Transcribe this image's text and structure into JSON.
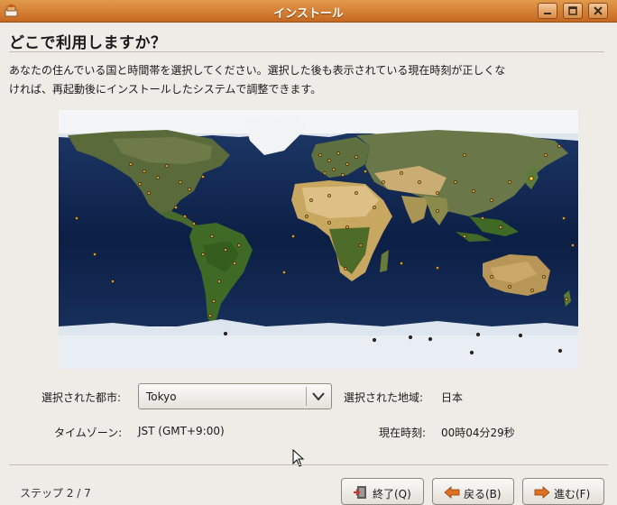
{
  "window": {
    "title": "インストール"
  },
  "page": {
    "heading": "どこで利用しますか？",
    "description_line1": "あなたの住んでいる国と時間帯を選択してください。選択した後も表示されている現在時刻が正しくな",
    "description_line2": "ければ、再起動後にインストールしたシステムで調整できます。"
  },
  "form": {
    "city_label": "選択された都市:",
    "city_value": "Tokyo",
    "region_label": "選択された地域:",
    "region_value": "日本",
    "timezone_label": "タイムゾーン:",
    "timezone_value": "JST (GMT+9:00)",
    "time_label": "現在時刻:",
    "time_value": "00時04分29秒"
  },
  "footer": {
    "step": "ステップ 2 / 7",
    "quit_label": "終了(Q)",
    "back_label": "戻る(B)",
    "forward_label": "進む(F)"
  },
  "colors": {
    "titlebar": "#d27a2e",
    "background": "#efebe7",
    "accent": "#e07020"
  },
  "icons": [
    "installer-icon",
    "minimize-icon",
    "maximize-icon",
    "close-icon",
    "chevron-down-icon",
    "quit-icon",
    "back-arrow-icon",
    "forward-arrow-icon",
    "mouse-cursor-icon"
  ]
}
